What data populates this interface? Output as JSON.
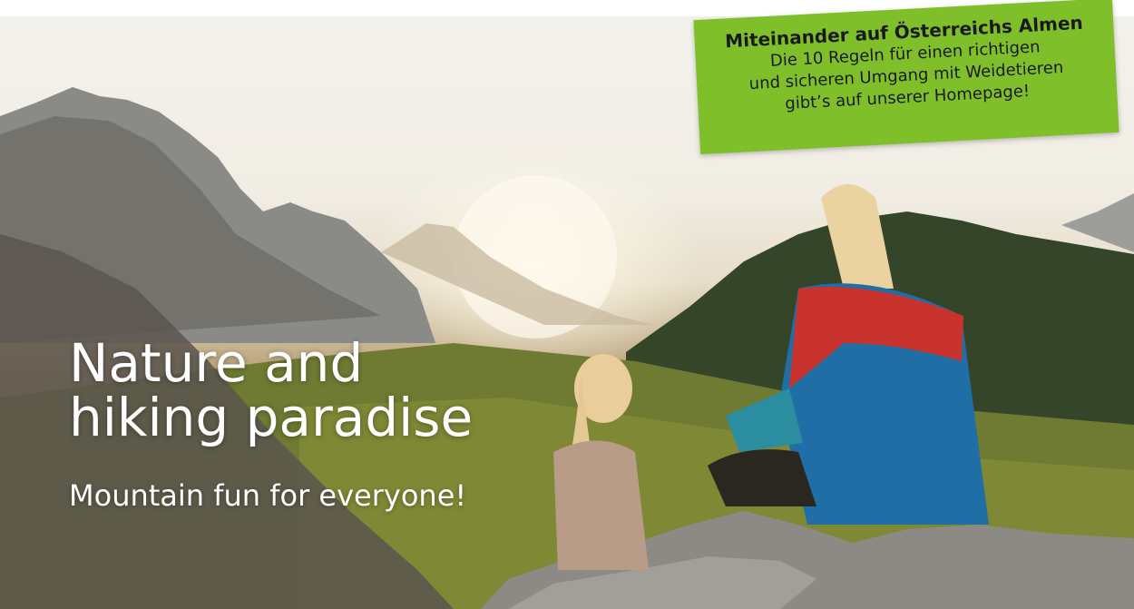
{
  "hero": {
    "headline_line1": "Nature and",
    "headline_line2": "hiking paradise",
    "subline": "Mountain fun for everyone!"
  },
  "notice": {
    "title": "Miteinander auf Österreichs Almen",
    "line1": "Die 10 Regeln für einen richtigen",
    "line2": "und sicheren Umgang mit Weidetieren",
    "line3": "gibt’s  auf unserer Homepage!",
    "color": "#7fbf2a"
  }
}
